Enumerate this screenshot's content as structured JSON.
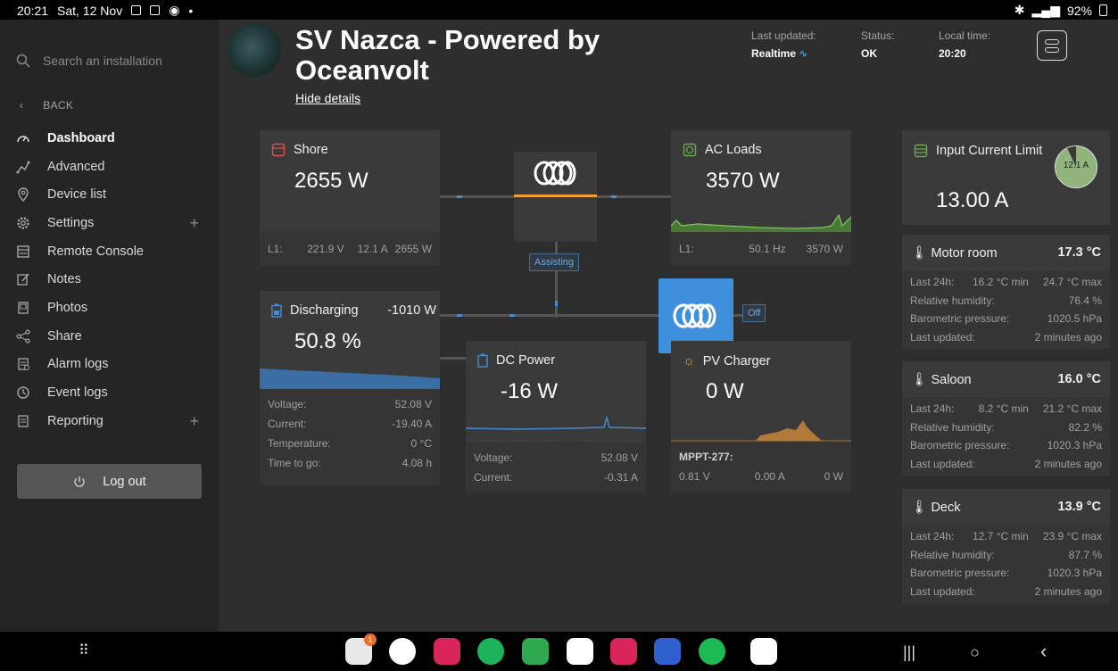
{
  "status_bar": {
    "time": "20:21",
    "date": "Sat, 12 Nov",
    "battery": "92%"
  },
  "sidebar": {
    "search_placeholder": "Search an installation",
    "back_label": "BACK",
    "items": [
      {
        "label": "Dashboard",
        "icon": "dashboard-icon",
        "active": true
      },
      {
        "label": "Advanced",
        "icon": "graph-icon"
      },
      {
        "label": "Device list",
        "icon": "location-pin-icon"
      },
      {
        "label": "Settings",
        "icon": "gear-icon",
        "expandable": true
      },
      {
        "label": "Remote Console",
        "icon": "console-icon"
      },
      {
        "label": "Notes",
        "icon": "pencil-icon"
      },
      {
        "label": "Photos",
        "icon": "photo-icon"
      },
      {
        "label": "Share",
        "icon": "share-icon"
      },
      {
        "label": "Alarm logs",
        "icon": "alarm-log-icon"
      },
      {
        "label": "Event logs",
        "icon": "clock-icon"
      },
      {
        "label": "Reporting",
        "icon": "report-icon",
        "expandable": true
      }
    ],
    "logout_label": "Log out"
  },
  "header": {
    "title": "SV Nazca - Powered by Oceanvolt",
    "hide_details": "Hide details",
    "last_updated_label": "Last updated:",
    "last_updated_value": "Realtime",
    "status_label": "Status:",
    "status_value": "OK",
    "local_time_label": "Local time:",
    "local_time_value": "20:20"
  },
  "shore": {
    "title": "Shore",
    "value": "2655 W",
    "l1": "L1:",
    "voltage": "221.9 V",
    "current": "12.1 A",
    "power": "2655 W"
  },
  "inverter": {
    "state": "Assisting"
  },
  "ac_loads": {
    "title": "AC Loads",
    "value": "3570 W",
    "l1": "L1:",
    "frequency": "50.1 Hz",
    "power": "3570 W"
  },
  "battery": {
    "title": "Discharging",
    "power": "-1010 W",
    "soc": "50.8 %",
    "rows": [
      {
        "label": "Voltage:",
        "value": "52.08 V"
      },
      {
        "label": "Current:",
        "value": "-19.40 A"
      },
      {
        "label": "Temperature:",
        "value": "0 °C"
      },
      {
        "label": "Time to go:",
        "value": "4.08 h"
      }
    ]
  },
  "dc_power": {
    "title": "DC Power",
    "value": "-16 W",
    "rows": [
      {
        "label": "Voltage:",
        "value": "52.08 V"
      },
      {
        "label": "Current:",
        "value": "-0.31 A"
      }
    ]
  },
  "solar": {
    "state": "Off"
  },
  "pv_charger": {
    "title": "PV Charger",
    "value": "0 W",
    "device": "MPPT-277:",
    "voltage": "0.81 V",
    "current": "0.00 A",
    "power": "0 W"
  },
  "input_limit": {
    "title": "Input Current Limit",
    "value": "13.00 A",
    "gauge_label": "12.1 A",
    "gauge_fraction": 0.93
  },
  "sensors": [
    {
      "name": "Motor room",
      "temp": "17.3 °C",
      "rows": [
        {
          "label": "Last 24h:",
          "min": "16.2 °C min",
          "max": "24.7 °C max"
        },
        {
          "label": "Relative humidity:",
          "value": "76.4 %"
        },
        {
          "label": "Barometric pressure:",
          "value": "1020.5 hPa"
        },
        {
          "label": "Last updated:",
          "value": "2 minutes ago"
        }
      ]
    },
    {
      "name": "Saloon",
      "temp": "16.0 °C",
      "rows": [
        {
          "label": "Last 24h:",
          "min": "8.2 °C min",
          "max": "21.2 °C max"
        },
        {
          "label": "Relative humidity:",
          "value": "82.2 %"
        },
        {
          "label": "Barometric pressure:",
          "value": "1020.3 hPa"
        },
        {
          "label": "Last updated:",
          "value": "2 minutes ago"
        }
      ]
    },
    {
      "name": "Deck",
      "temp": "13.9 °C",
      "rows": [
        {
          "label": "Last 24h:",
          "min": "12.7 °C min",
          "max": "23.9 °C max"
        },
        {
          "label": "Relative humidity:",
          "value": "87.7 %"
        },
        {
          "label": "Barometric pressure:",
          "value": "1020.3 hPa"
        },
        {
          "label": "Last updated:",
          "value": "2 minutes ago"
        }
      ]
    }
  ],
  "taskbar": {
    "badge": "1"
  },
  "colors": {
    "accent_orange": "#f0a030",
    "victron_blue": "#3f8fdc",
    "ac_green": "#6aa84f",
    "battery_blue": "#3a6ea5"
  }
}
